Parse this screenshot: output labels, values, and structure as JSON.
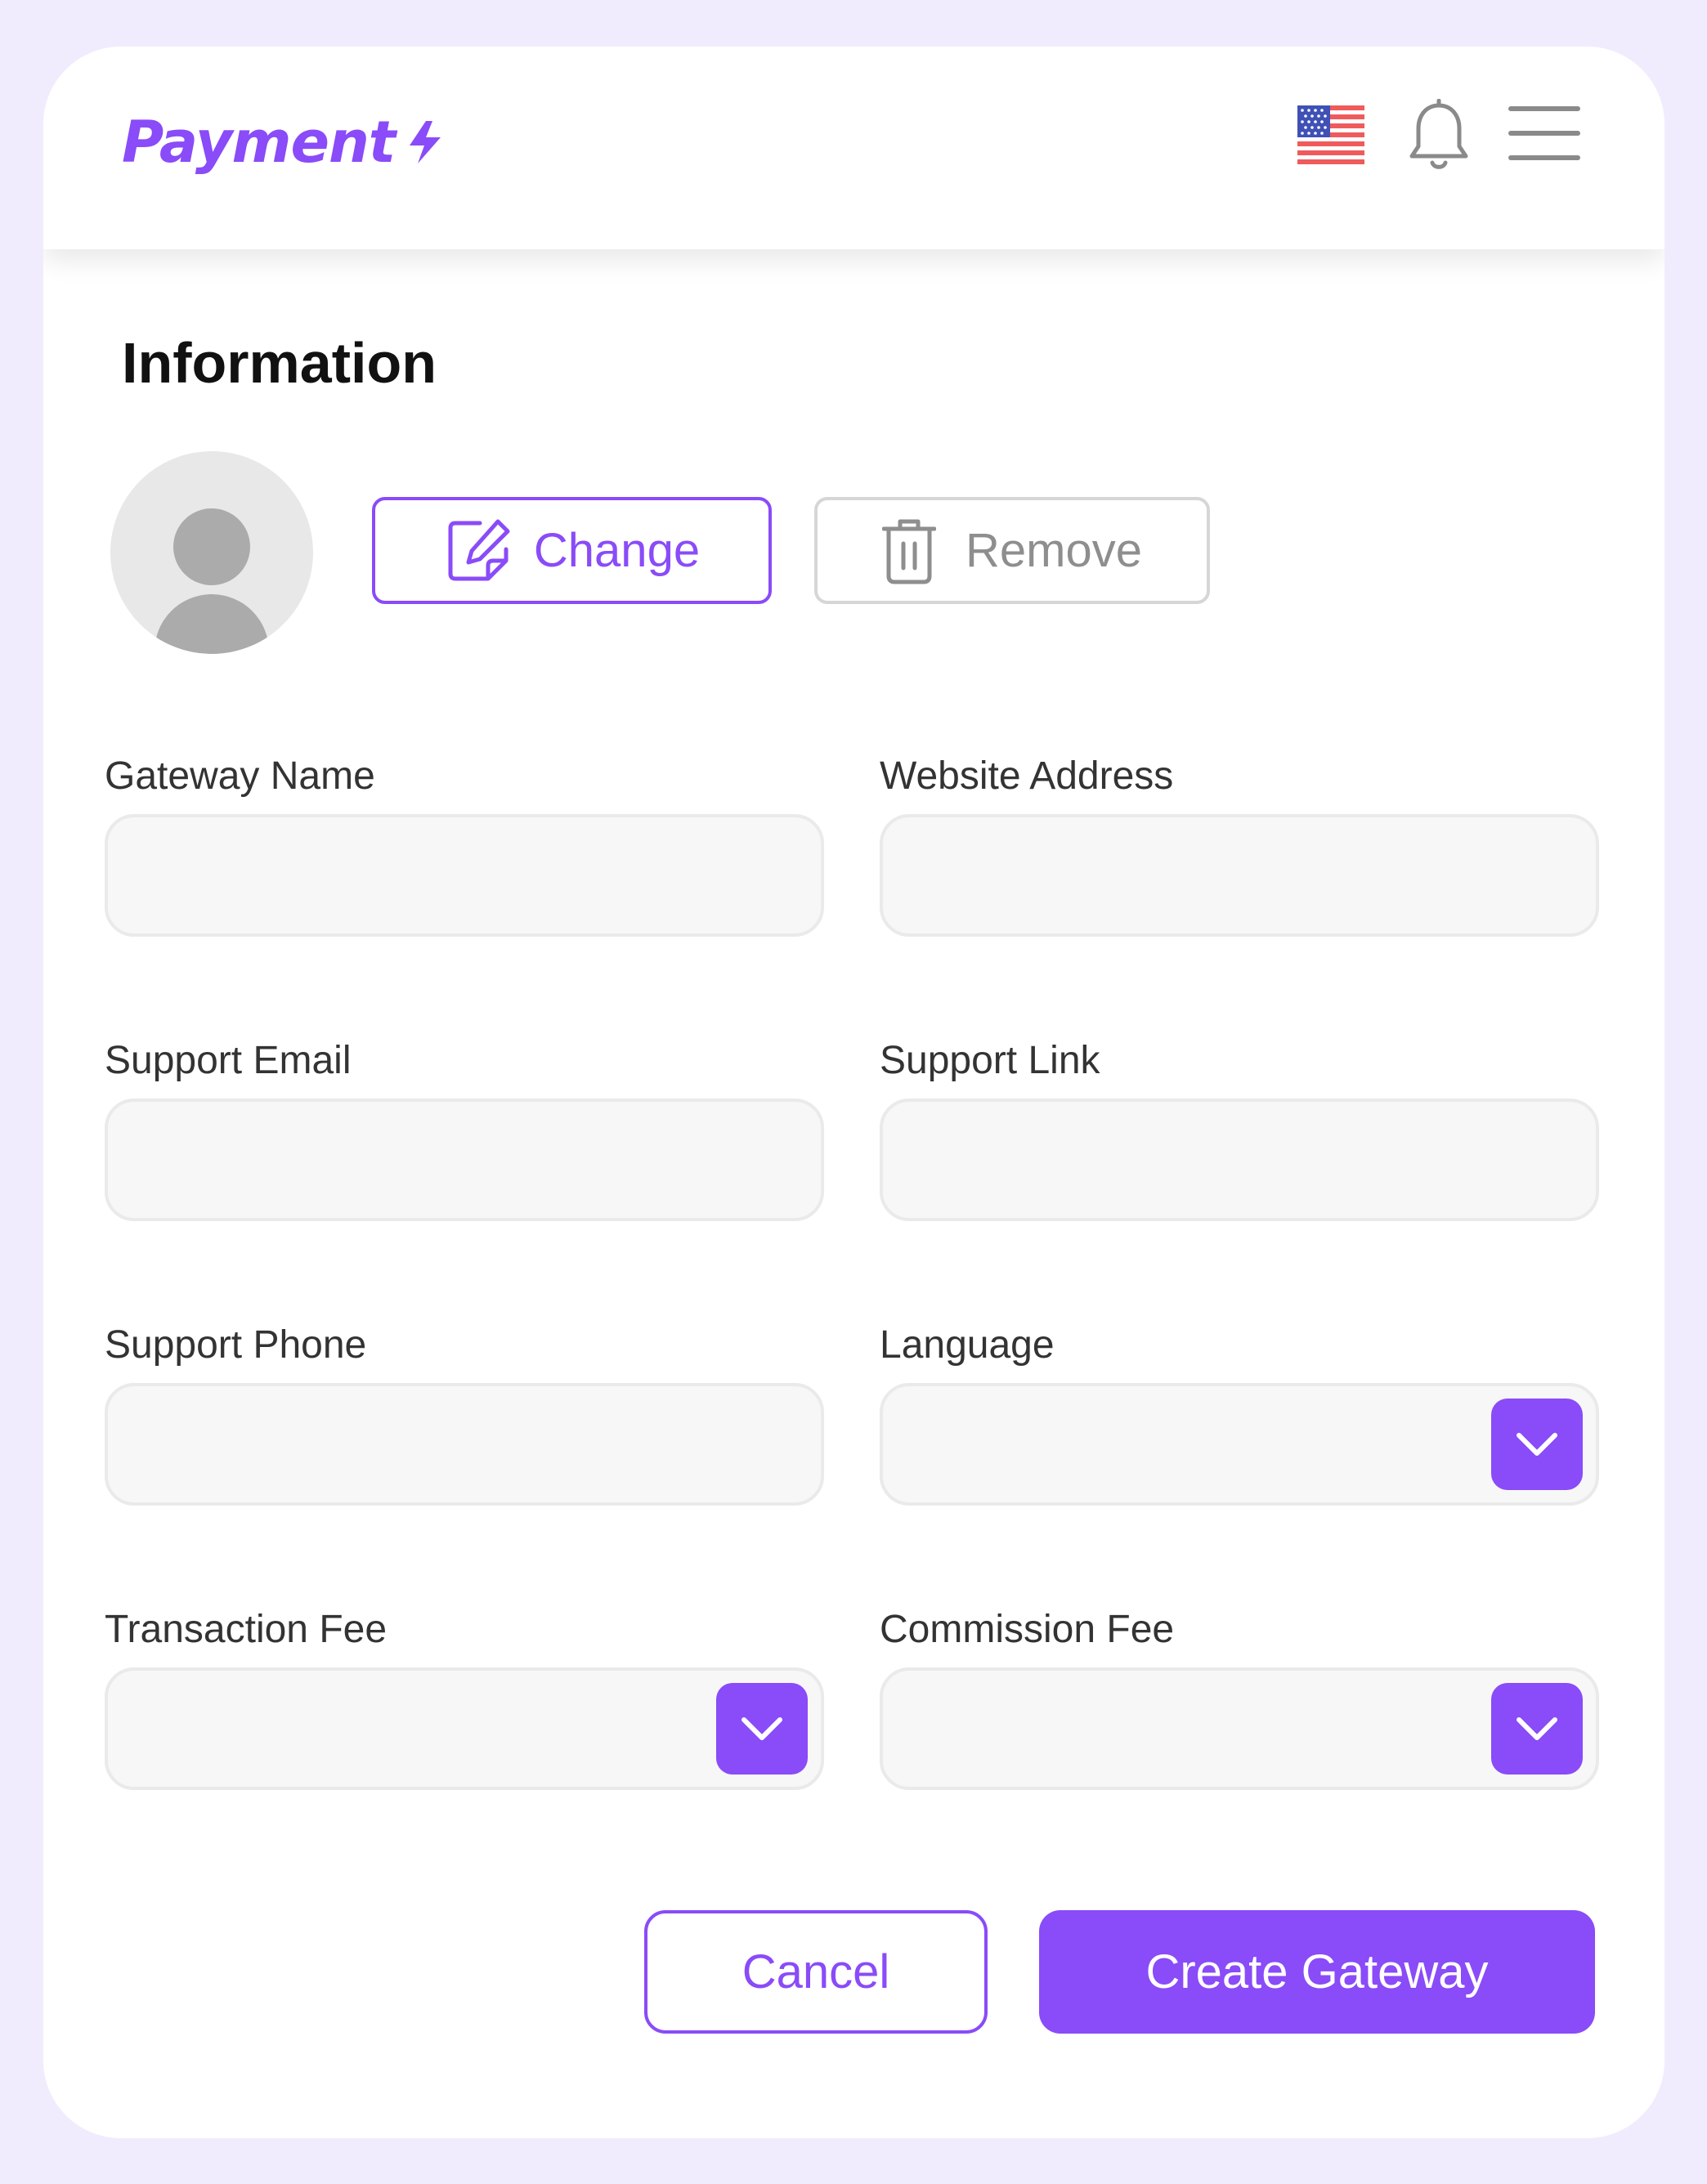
{
  "header": {
    "logo_text": "Payment",
    "flag_icon": "us-flag-icon",
    "notification_icon": "bell-icon",
    "menu_icon": "hamburger-menu-icon"
  },
  "page": {
    "title": "Information"
  },
  "avatar": {
    "icon": "user-avatar-placeholder-icon",
    "change_label": "Change",
    "change_icon": "edit-icon",
    "remove_label": "Remove",
    "remove_icon": "trash-icon"
  },
  "form": {
    "gateway_name": {
      "label": "Gateway Name",
      "value": ""
    },
    "website_address": {
      "label": "Website Address",
      "value": ""
    },
    "support_email": {
      "label": "Support Email",
      "value": ""
    },
    "support_link": {
      "label": "Support Link",
      "value": ""
    },
    "support_phone": {
      "label": "Support Phone",
      "value": ""
    },
    "language": {
      "label": "Language",
      "value": ""
    },
    "transaction_fee": {
      "label": "Transaction Fee",
      "value": ""
    },
    "commission_fee": {
      "label": "Commission Fee",
      "value": ""
    }
  },
  "actions": {
    "cancel_label": "Cancel",
    "create_label": "Create Gateway"
  },
  "colors": {
    "accent": "#8A4BF8",
    "background": "#F1ECFD",
    "field_bg": "#F7F7F7",
    "field_border": "#EAEAEA"
  }
}
